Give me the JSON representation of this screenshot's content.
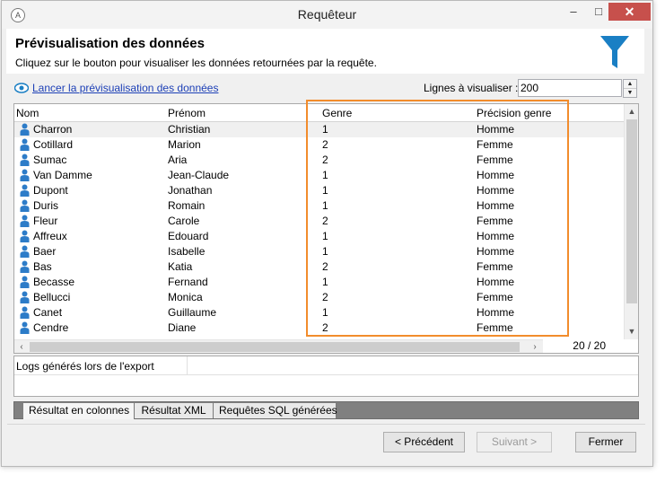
{
  "window": {
    "title": "Requêteur",
    "controls": {
      "minimize": "–",
      "maximize": "□",
      "close": "✕"
    }
  },
  "header": {
    "title": "Prévisualisation des données",
    "subtitle": "Cliquez sur le bouton pour visualiser les données retournées par la requête."
  },
  "toolbar": {
    "preview_link": "Lancer la prévisualisation des données",
    "lines_label": "Lignes à visualiser :",
    "lines_value": "200"
  },
  "grid": {
    "columns": [
      "Nom",
      "Prénom",
      "Genre",
      "Précision genre"
    ],
    "rows": [
      [
        "Charron",
        "Christian",
        "1",
        "Homme"
      ],
      [
        "Cotillard",
        "Marion",
        "2",
        "Femme"
      ],
      [
        "Sumac",
        "Aria",
        "2",
        "Femme"
      ],
      [
        "Van Damme",
        "Jean-Claude",
        "1",
        "Homme"
      ],
      [
        "Dupont",
        "Jonathan",
        "1",
        "Homme"
      ],
      [
        "Duris",
        "Romain",
        "1",
        "Homme"
      ],
      [
        "Fleur",
        "Carole",
        "2",
        "Femme"
      ],
      [
        "Affreux",
        "Edouard",
        "1",
        "Homme"
      ],
      [
        "Baer",
        "Isabelle",
        "1",
        "Homme"
      ],
      [
        "Bas",
        "Katia",
        "2",
        "Femme"
      ],
      [
        "Becasse",
        "Fernand",
        "1",
        "Homme"
      ],
      [
        "Bellucci",
        "Monica",
        "2",
        "Femme"
      ],
      [
        "Canet",
        "Guillaume",
        "1",
        "Homme"
      ],
      [
        "Cendre",
        "Diane",
        "2",
        "Femme"
      ]
    ],
    "counter": "20 / 20"
  },
  "logs": {
    "title": "Logs générés lors de l'export"
  },
  "tabs": [
    "Résultat en colonnes",
    "Résultat XML",
    "Requêtes SQL générées"
  ],
  "buttons": {
    "previous": "< Précédent",
    "next": "Suivant >",
    "close": "Fermer"
  },
  "colors": {
    "accent": "#1a7fc4",
    "highlight": "#f28c2c",
    "link": "#1c3fb6"
  }
}
